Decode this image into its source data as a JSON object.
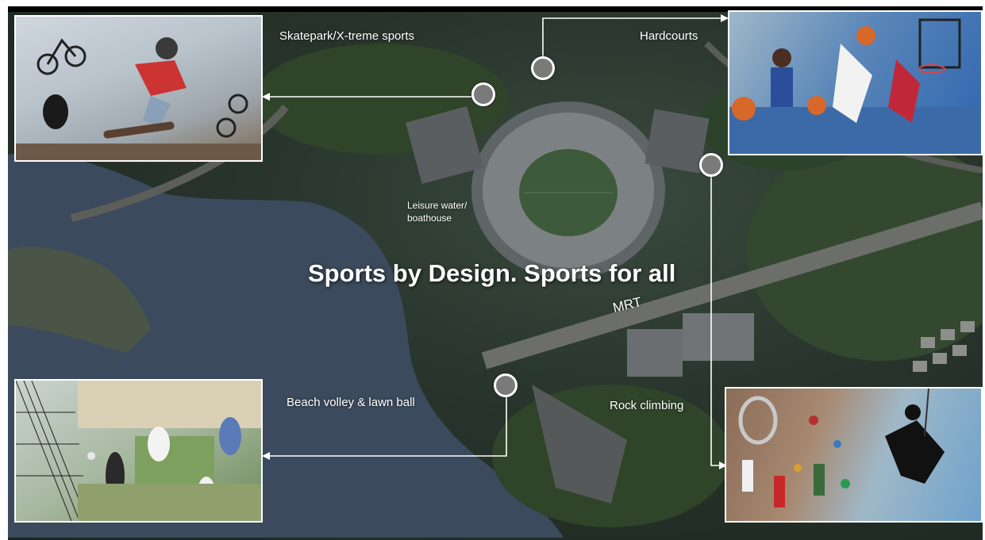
{
  "headline": "Sports by Design. Sports for all",
  "features": {
    "skatepark": {
      "label": "Skatepark/X-treme  sports",
      "icon": "skateboard-icon"
    },
    "hardcourts": {
      "label": "Hardcourts",
      "icon": "basketball-icon"
    },
    "beach_volley": {
      "label": "Beach volley & lawn ball",
      "icon": "volleyball-icon"
    },
    "rock_climbing": {
      "label": "Rock climbing",
      "icon": "climbing-icon"
    }
  },
  "map_labels": {
    "leisure_water": "Leisure water/\nboathouse",
    "mrt": "MRT"
  },
  "colors": {
    "water": "#3b4a5c",
    "greenery": "#2f4a2e",
    "marker": "#7a7a7a",
    "connector": "#ffffff"
  }
}
